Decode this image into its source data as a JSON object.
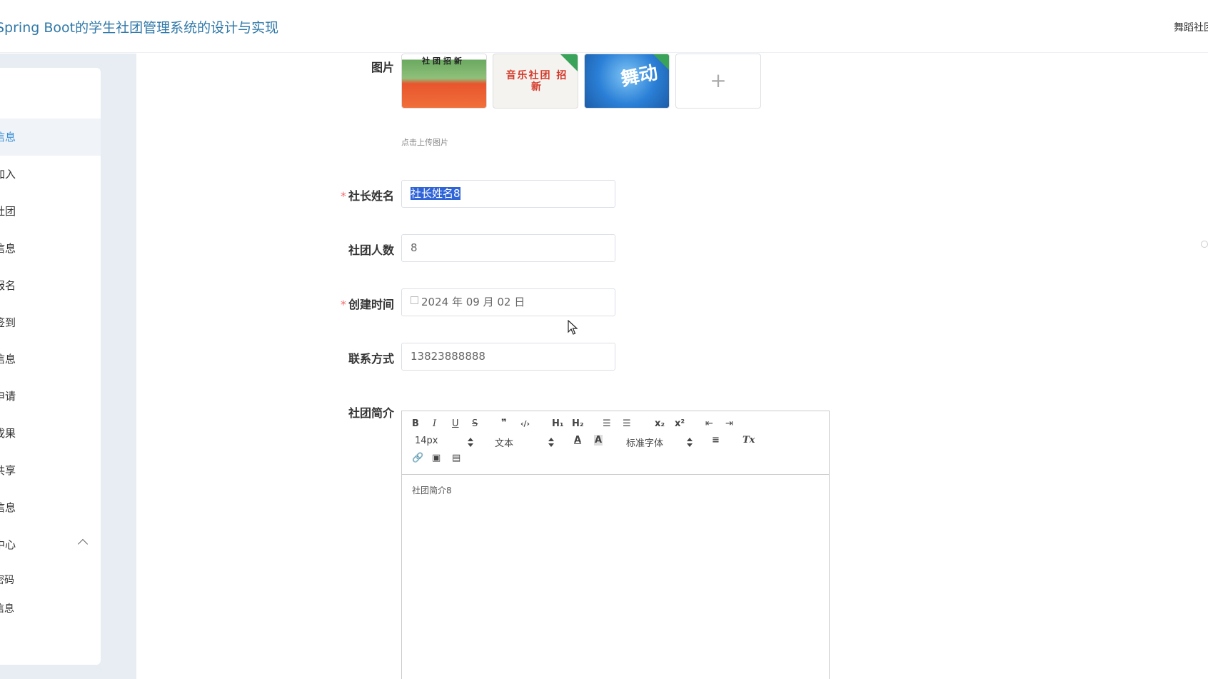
{
  "header": {
    "app_title": "Spring Boot的学生社团管理系统的设计与实现",
    "user_label": "舞蹈社团"
  },
  "sidebar": {
    "items": [
      {
        "label": "信息",
        "active": true
      },
      {
        "label": "加入"
      },
      {
        "label": "社团"
      },
      {
        "label": "信息"
      },
      {
        "label": "报名"
      },
      {
        "label": "签到"
      },
      {
        "label": "信息"
      },
      {
        "label": "申请"
      },
      {
        "label": "成果"
      },
      {
        "label": "共享"
      },
      {
        "label": "信息"
      },
      {
        "label": "中心",
        "expanded": true
      },
      {
        "label": "密码"
      },
      {
        "label": "信息"
      }
    ]
  },
  "form": {
    "image_label": "图片",
    "upload_plus": "+",
    "upload_hint": "点击上传图片",
    "images": [
      {
        "caption": "社团招新",
        "icon": "photo-icon"
      },
      {
        "caption": "音乐社团 招新",
        "icon": "photo-icon"
      },
      {
        "caption": "舞动",
        "icon": "photo-icon"
      }
    ],
    "leader_label": "社长姓名",
    "leader_value": "社长姓名8",
    "members_label": "社团人数",
    "members_value": "8",
    "created_label": "创建时间",
    "created_value": "2024 年 09 月 02 日",
    "contact_label": "联系方式",
    "contact_value": "13823888888",
    "intro_label": "社团简介",
    "required_mark": "*"
  },
  "editor": {
    "toolbar": {
      "bold": "B",
      "italic": "I",
      "underline": "U",
      "strike": "S",
      "quote": "❞",
      "code": "‹/›",
      "h1": "H₁",
      "h2": "H₂",
      "ordered_list": "☰",
      "bullet_list": "☰",
      "sub": "x₂",
      "sup": "x²",
      "outdent": "⇤",
      "indent": "⇥",
      "size": "14px",
      "header": "文本",
      "color": "A",
      "background": "A",
      "font": "标准字体",
      "align": "≡",
      "clean": "Tx",
      "link": "🔗",
      "image": "▣",
      "video": "▤"
    },
    "content": "社团简介8"
  },
  "colors": {
    "accent": "#2f78a8",
    "active_menu": "#3a8fd6",
    "required": "#f56c6c",
    "selection": "#2f63d8"
  }
}
